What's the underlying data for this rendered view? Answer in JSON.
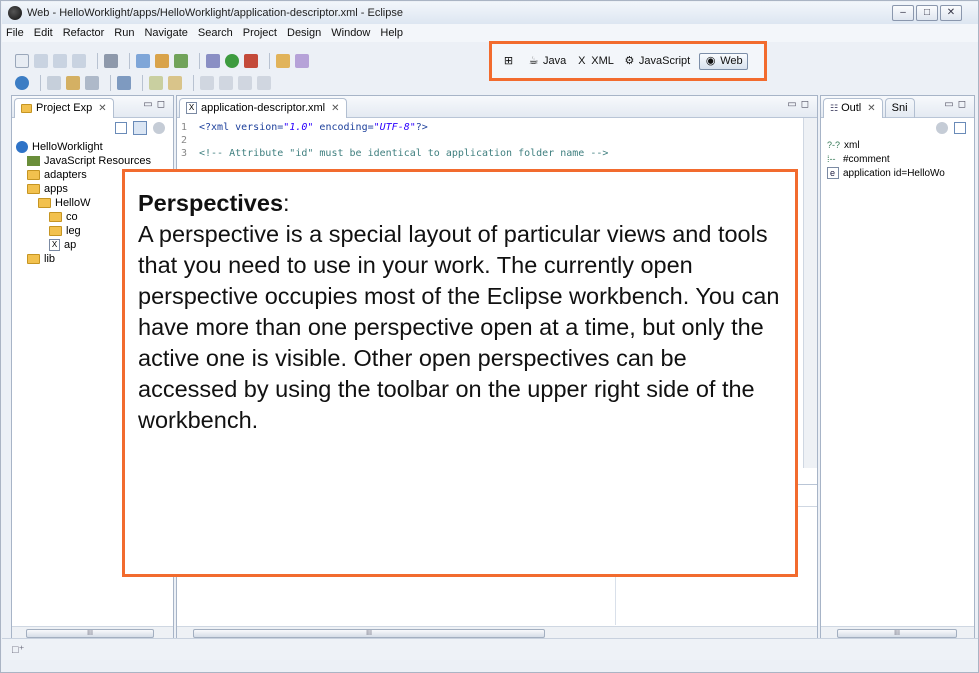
{
  "window": {
    "title": "Web - HelloWorklight/apps/HelloWorklight/application-descriptor.xml - Eclipse",
    "controls": [
      "–",
      "□",
      "✕"
    ]
  },
  "menu": [
    "File",
    "Edit",
    "Refactor",
    "Run",
    "Navigate",
    "Search",
    "Project",
    "Design",
    "Window",
    "Help"
  ],
  "perspectives": {
    "items": [
      {
        "label": "Java",
        "icon": "java-perspective-icon",
        "glyph": "☕"
      },
      {
        "label": "XML",
        "icon": "xml-perspective-icon",
        "glyph": "X"
      },
      {
        "label": "JavaScript",
        "icon": "javascript-perspective-icon",
        "glyph": "⚙"
      },
      {
        "label": "Web",
        "icon": "web-perspective-icon",
        "glyph": "◉",
        "active": true
      }
    ],
    "highlight_color": "#f26b2e"
  },
  "project_explorer": {
    "tab_label": "Project Exp",
    "close": "✕",
    "tree": [
      {
        "label": "HelloWorklight",
        "icon": "project",
        "depth": 0
      },
      {
        "label": "JavaScript Resources",
        "icon": "js",
        "depth": 1
      },
      {
        "label": "adapters",
        "icon": "folder",
        "depth": 1
      },
      {
        "label": "apps",
        "icon": "folder",
        "depth": 1
      },
      {
        "label": "HelloW",
        "icon": "folder",
        "depth": 2
      },
      {
        "label": "co",
        "icon": "folder",
        "depth": 3
      },
      {
        "label": "leg",
        "icon": "folder",
        "depth": 3
      },
      {
        "label": "ap",
        "icon": "xml",
        "depth": 3
      },
      {
        "label": "lib",
        "icon": "folder",
        "depth": 1
      }
    ]
  },
  "editor": {
    "tab_label": "application-descriptor.xml",
    "close": "✕",
    "lines": [
      {
        "n": "1",
        "pre": "<?xml version=",
        "s1": "\"1.0\"",
        "mid": " encoding=",
        "s2": "\"UTF-8\"",
        "post": "?>",
        "type": "pi"
      },
      {
        "n": "2",
        "text": "",
        "type": "blank"
      },
      {
        "n": "3",
        "text": "<!-- Attribute \"id\" must be identical to application folder name -->",
        "type": "comment"
      }
    ]
  },
  "outline": {
    "tab_label": "Outl",
    "tab2_label": "Sni",
    "items": [
      {
        "label": "xml",
        "icon": "?-?"
      },
      {
        "label": "#comment",
        "icon": "⁞--"
      },
      {
        "label": "application id=HelloWo",
        "icon": "e"
      }
    ]
  },
  "callout": {
    "heading": "Perspectives",
    "heading_suffix": ":",
    "body": "A perspective is a special layout of particular views and tools that you need to use in your work. The currently open perspective occupies most of the Eclipse workbench. You can have more than one perspective open at a time, but only the active one is visible. Other open perspectives can be accessed by using the toolbar on the upper right side of the workbench.",
    "border_color": "#f26b2e"
  },
  "scroll_grip": "III"
}
